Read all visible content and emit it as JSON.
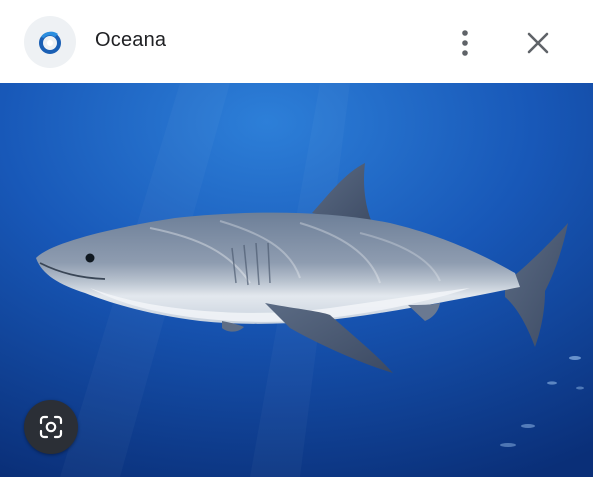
{
  "header": {
    "site_name": "Oceana",
    "logo_icon": "oceana-logo-icon",
    "more_icon": "more-vert-icon",
    "close_icon": "close-icon"
  },
  "image": {
    "subject": "great-white-shark-photo"
  },
  "lens": {
    "icon": "google-lens-icon"
  },
  "colors": {
    "header_bg": "#ffffff",
    "ocean_deep": "#0b3a8c",
    "ocean_light": "#1f6fd0",
    "brand_blue": "#1a5fb4",
    "lens_bg": "#2b2f36"
  }
}
